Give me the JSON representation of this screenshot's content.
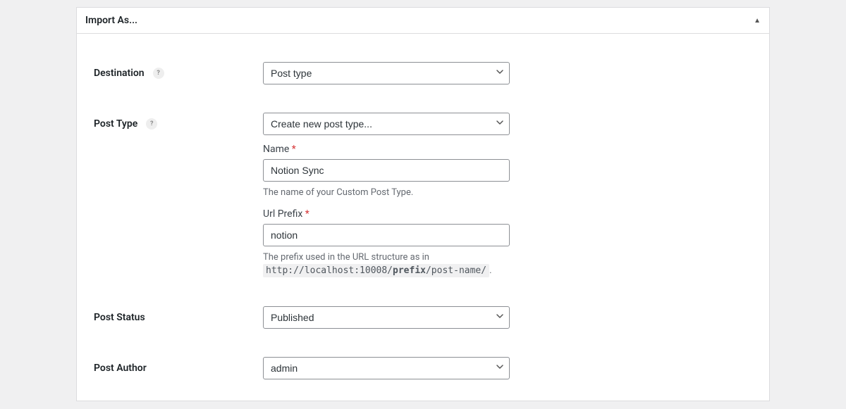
{
  "panel": {
    "title": "Import As..."
  },
  "destination": {
    "label": "Destination",
    "value": "Post type"
  },
  "postType": {
    "label": "Post Type",
    "value": "Create new post type...",
    "name": {
      "label": "Name",
      "value": "Notion Sync",
      "helper": "The name of your Custom Post Type."
    },
    "urlPrefix": {
      "label": "Url Prefix",
      "value": "notion",
      "helperPrefix": "The prefix used in the URL structure as in",
      "urlBefore": "http://localhost:10008/",
      "urlBold": "prefix",
      "urlAfter": "/post-name/",
      "helperSuffix": "."
    }
  },
  "postStatus": {
    "label": "Post Status",
    "value": "Published"
  },
  "postAuthor": {
    "label": "Post Author",
    "value": "admin"
  },
  "asterisk": "*",
  "helpIcon": "?"
}
